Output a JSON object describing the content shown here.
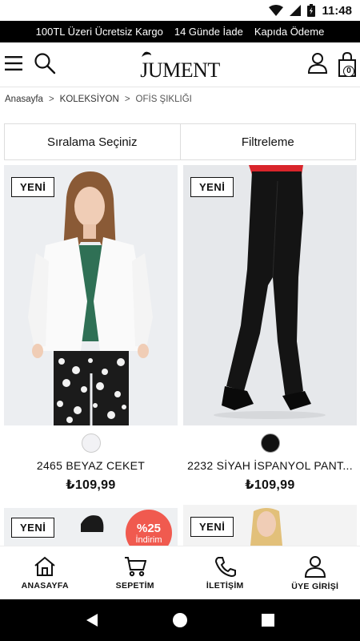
{
  "status_bar": {
    "time": "11:48"
  },
  "promo_bar": {
    "items": [
      "100TL Üzeri Ücretsiz Kargo",
      "14 Günde İade",
      "Kapıda Ödeme"
    ]
  },
  "header": {
    "logo_text": "JUMENT",
    "cart_count": "0"
  },
  "breadcrumb": {
    "items": [
      "Anasayfa",
      "KOLEKSİYON",
      "OFİS ŞIKLIĞI"
    ],
    "separator": ">"
  },
  "sortbar": {
    "sort_label": "Sıralama Seçiniz",
    "filter_label": "Filtreleme"
  },
  "products": [
    {
      "badge": "YENİ",
      "name": "2465 BEYAZ CEKET",
      "price": "₺109,99",
      "swatch_color": "#f2f2f5"
    },
    {
      "badge": "YENİ",
      "name": "2232 SİYAH İSPANYOL PANT...",
      "price": "₺109,99",
      "swatch_color": "#111111"
    },
    {
      "badge": "YENİ",
      "discount_pct": "%25",
      "discount_label": "İndirim"
    },
    {
      "badge": "YENİ"
    }
  ],
  "bottom_nav": [
    {
      "label": "ANASAYFA",
      "icon": "home-icon"
    },
    {
      "label": "SEPETİM",
      "icon": "cart-icon"
    },
    {
      "label": "İLETİŞİM",
      "icon": "phone-icon"
    },
    {
      "label": "ÜYE GİRİŞİ",
      "icon": "user-icon"
    }
  ],
  "colors": {
    "promo_bg": "#000000",
    "discount": "#f05a4f"
  }
}
